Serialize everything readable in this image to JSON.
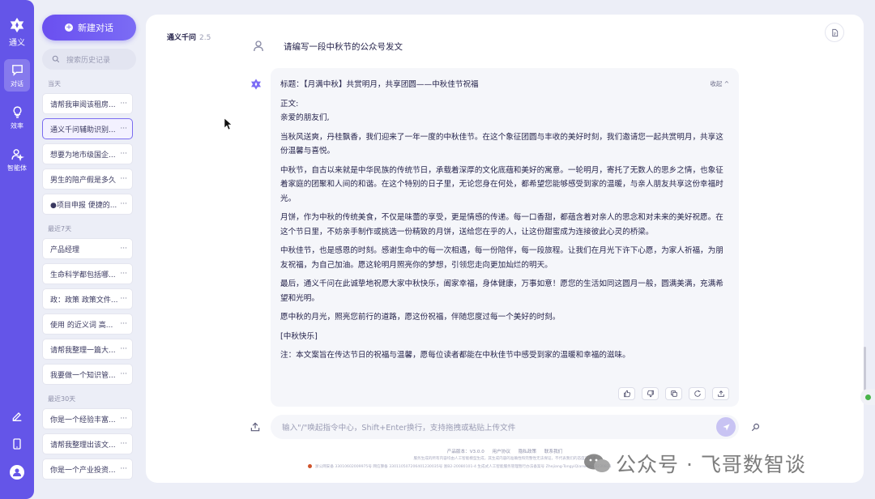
{
  "rail": {
    "brand": "通义",
    "items": [
      {
        "label": "对话",
        "icon": "chat-icon",
        "active": true
      },
      {
        "label": "效率",
        "icon": "bulb-icon",
        "active": false
      },
      {
        "label": "智能体",
        "icon": "agent-icon",
        "active": false
      }
    ]
  },
  "sidebar": {
    "new_chat": "新建对话",
    "search_placeholder": "搜索历史记录",
    "sections": [
      {
        "title": "当天",
        "items": [
          "请帮我审阅该租房...",
          "通义千问辅助识别...",
          "想要为地市级国企...",
          "男生的陪产假是多久",
          "●项目申报 便捷的..."
        ]
      },
      {
        "title": "最近7天",
        "items": [
          "产品经理",
          "生命科学都包括哪...",
          "政：政策 政策文件...",
          "使用 的近义词 高...",
          "请帮我整理一篇大...",
          "我要做一个知识管..."
        ]
      },
      {
        "title": "最近30天",
        "items": [
          "你是一个经验丰富...",
          "请帮我整理出该文...",
          "你是一个产业投资..."
        ]
      }
    ],
    "more": "···"
  },
  "header": {
    "model": "通义千问",
    "version": "2.5"
  },
  "conversation": {
    "user_message": "请编写一段中秋节的公众号发文",
    "collapse_label": "收起 ^",
    "answer": {
      "title": "标题：【月满中秋】共赏明月，共享团圆——中秋佳节祝福",
      "body_label": "正文:",
      "greeting": "亲爱的朋友们,",
      "paragraphs": [
        "当秋风送爽，丹桂飘香，我们迎来了一年一度的中秋佳节。在这个象征团圆与丰收的美好时刻，我们邀请您一起共赏明月，共享这份温馨与喜悦。",
        "中秋节，自古以来就是中华民族的传统节日，承载着深厚的文化底蕴和美好的寓意。一轮明月，寄托了无数人的思乡之情，也象征着家庭的团聚和人间的和谐。在这个特别的日子里，无论您身在何处，都希望您能够感受到家的温暖，与亲人朋友共享这份幸福时光。",
        "月饼，作为中秋的传统美食，不仅是味蕾的享受，更是情感的传递。每一口香甜，都蕴含着对亲人的思念和对未来的美好祝愿。在这个节日里，不妨亲手制作或挑选一份精致的月饼，送给您在乎的人，让这份甜蜜成为连接彼此心灵的桥梁。",
        "中秋佳节，也是感恩的时刻。感谢生命中的每一次相遇，每一份陪伴，每一段旅程。让我们在月光下许下心愿，为家人祈福，为朋友祝福，为自己加油。愿这轮明月照亮你的梦想，引领您走向更加灿烂的明天。",
        "最后，通义千问在此诚挚地祝愿大家中秋快乐，阖家幸福，身体健康，万事如意！愿您的生活如同这圆月一般，圆满美满，充满希望和光明。",
        "愿中秋的月光，照亮您前行的道路，愿这份祝福，伴随您度过每一个美好的时刻。",
        "[中秋快乐]",
        "注：本文案旨在传达节日的祝福与温馨，愿每位读者都能在中秋佳节中感受到家的温暖和幸福的滋味。"
      ]
    }
  },
  "composer": {
    "placeholder": "输入\"/\"唤起指令中心，Shift+Enter换行，支持拖拽或粘贴上传文件"
  },
  "footer": {
    "links": [
      "产品版本：V3.0.0",
      "用户协议",
      "隐私政策",
      "联系我们"
    ],
    "disclaimer": "服务生成的所有内容均由人工智能模型生成，其生成内容的准确性和完整性无法保证，不代表我们的态度或观点",
    "records": "浙公网安备 33010602009975号    网信算备 330110507206401230035号    浙B2-20080101-4    生成式人工智能服务管理暂行办法备案号 Zhejiang-TongyiQianwen-20230821"
  },
  "watermark": {
    "text": "公众号 · 飞哥数智谈"
  },
  "colors": {
    "rail": "#6455e8",
    "accent": "#7b6cf5",
    "background": "#eceef7"
  }
}
